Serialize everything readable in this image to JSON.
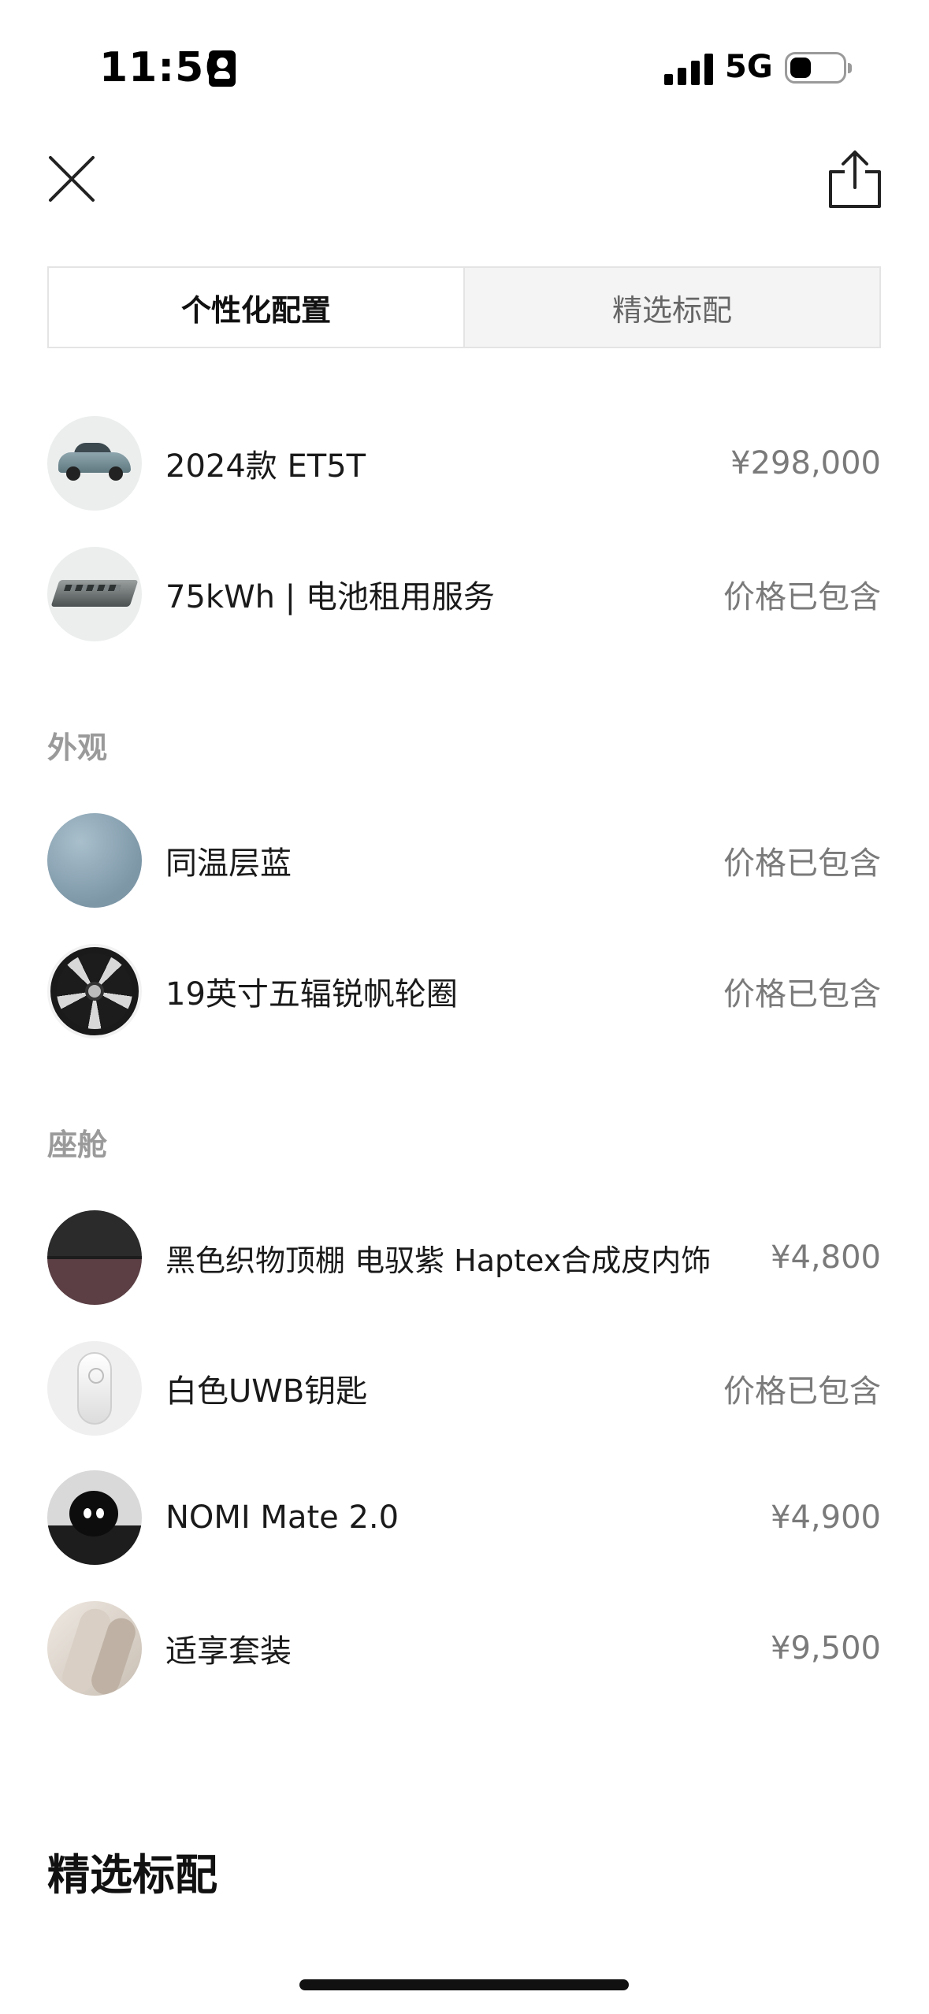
{
  "status_bar": {
    "time": "11:56",
    "network": "5G",
    "icons": [
      "person-badge-icon",
      "signal-icon",
      "battery-icon"
    ]
  },
  "header": {
    "close_icon": "close-icon",
    "share_icon": "share-icon"
  },
  "tabs": [
    {
      "label": "个性化配置",
      "active": true
    },
    {
      "label": "精选标配",
      "active": false
    }
  ],
  "config": {
    "items": [
      {
        "name": "2024款 ET5T",
        "price": "¥298,000",
        "thumb": "car-thumbnail"
      },
      {
        "name": "75kWh | 电池租用服务",
        "price": "价格已包含",
        "thumb": "battery-thumbnail"
      }
    ]
  },
  "exterior": {
    "label": "外观",
    "items": [
      {
        "name": "同温层蓝",
        "price": "价格已包含",
        "thumb": "paint-swatch"
      },
      {
        "name": "19英寸五辐锐帆轮圈",
        "price": "价格已包含",
        "thumb": "wheel-thumbnail"
      }
    ]
  },
  "cabin": {
    "label": "座舱",
    "items": [
      {
        "name": "黑色织物顶棚 电驭紫 Haptex合成皮内饰",
        "price": "¥4,800",
        "thumb": "interior-swatch"
      },
      {
        "name": "白色UWB钥匙",
        "price": "价格已包含",
        "thumb": "key-thumbnail"
      },
      {
        "name": "NOMI Mate 2.0",
        "price": "¥4,900",
        "thumb": "nomi-thumbnail"
      },
      {
        "name": "适享套装",
        "price": "¥9,500",
        "thumb": "seat-thumbnail"
      }
    ]
  },
  "standard_section": {
    "heading": "精选标配"
  },
  "colors": {
    "text_primary": "#1a1a1a",
    "text_secondary": "#7a7a7a",
    "section_label": "#9a9a9a",
    "tab_inactive_bg": "#f4f4f4",
    "paint_swatch": "#8aa3b2"
  }
}
